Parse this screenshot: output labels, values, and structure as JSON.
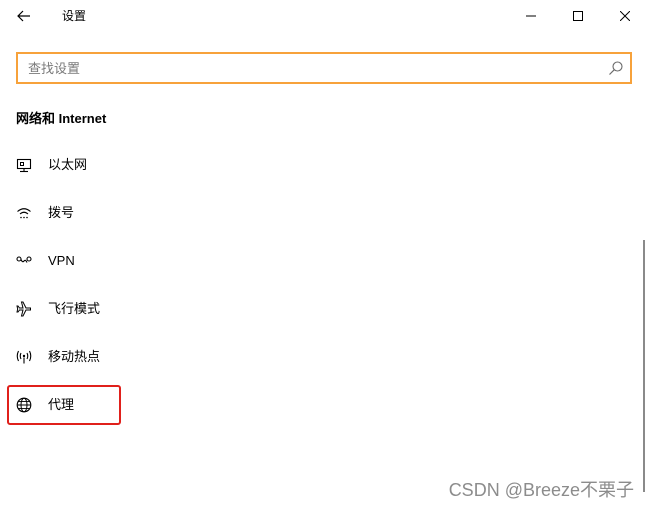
{
  "window": {
    "title": "设置"
  },
  "search": {
    "placeholder": "查找设置",
    "value": ""
  },
  "section": {
    "heading": "网络和 Internet"
  },
  "nav": {
    "items": [
      {
        "label": "以太网",
        "icon": "ethernet-icon"
      },
      {
        "label": "拨号",
        "icon": "dialup-icon"
      },
      {
        "label": "VPN",
        "icon": "vpn-icon"
      },
      {
        "label": "飞行模式",
        "icon": "airplane-icon"
      },
      {
        "label": "移动热点",
        "icon": "hotspot-icon"
      },
      {
        "label": "代理",
        "icon": "globe-icon"
      }
    ]
  },
  "highlight_color": "#e0201b",
  "search_border_color": "#f7a23b",
  "watermark": "CSDN @Breeze不栗子"
}
